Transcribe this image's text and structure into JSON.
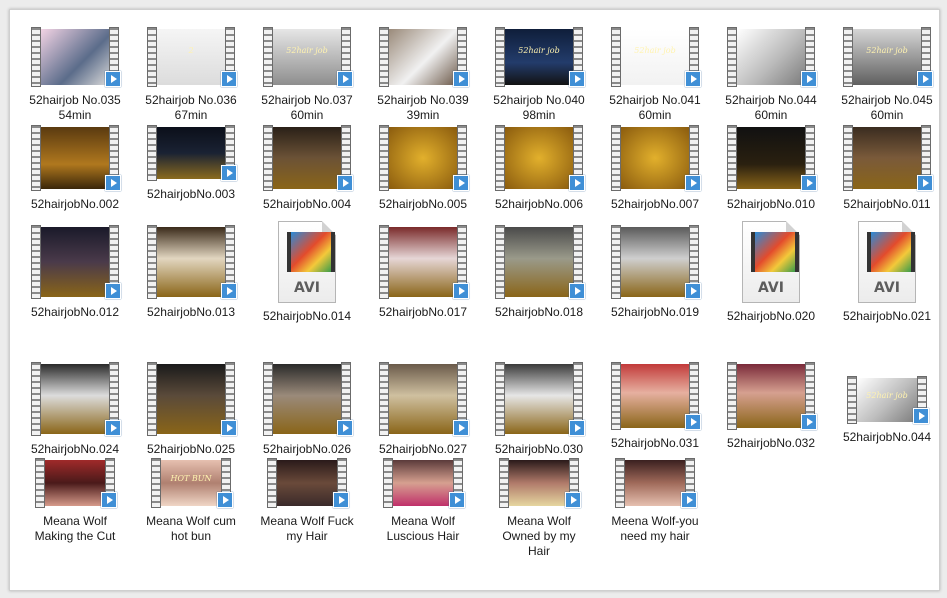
{
  "icons": {
    "play_badge": "play-badge-icon",
    "avi_file": "avi-file-icon"
  },
  "avi_label": "AVI",
  "items": [
    {
      "label": [
        "52hairjob No.035",
        "54min"
      ],
      "kind": "video",
      "bg": "linear-gradient(135deg,#f2d3e4,#5b6c8a 60%,#d9d9d9)"
    },
    {
      "label": [
        "52hairjob No.036",
        "67min"
      ],
      "kind": "video",
      "bg": "linear-gradient(#f5f5f5,#dcdcdc)",
      "caption": "2"
    },
    {
      "label": [
        "52hairjob No.037",
        "60min"
      ],
      "kind": "video",
      "bg": "linear-gradient(#e6e6e6,#8e8e8e)",
      "caption": "52hair job"
    },
    {
      "label": [
        "52hairjob No.039",
        "39min"
      ],
      "kind": "video",
      "bg": "linear-gradient(135deg,#9a8a7a,#f1f1f1 55%,#6d5a4a)"
    },
    {
      "label": [
        "52hairjob No.040",
        "98min"
      ],
      "kind": "video",
      "bg": "linear-gradient(#0f1e3a,#233c6b 60%,#121212)",
      "caption": "52hair job"
    },
    {
      "label": [
        "52hairjob No.041",
        "60min"
      ],
      "kind": "video",
      "bg": "linear-gradient(#ffffff,#f2f2f2)",
      "caption": "52hair job"
    },
    {
      "label": [
        "52hairjob No.044",
        "60min"
      ],
      "kind": "video",
      "bg": "linear-gradient(135deg,#ffffff,#bdbdbd 55%,#7b7b7b)"
    },
    {
      "label": [
        "52hairjob No.045",
        "60min"
      ],
      "kind": "video",
      "bg": "linear-gradient(#d6d6d6,#5f5f5f)",
      "caption": "52hair job"
    },
    {
      "label": [
        "52hairjobNo.002"
      ],
      "kind": "video",
      "bg": "linear-gradient(#5a3a10,#b0781e 60%,#3a260a)"
    },
    {
      "label": [
        "52hairjobNo.003"
      ],
      "kind": "video",
      "bg": "linear-gradient(#0b0f1a,#1a2233 50%,#8a6b1f)"
    },
    {
      "label": [
        "52hairjobNo.004"
      ],
      "kind": "video",
      "bg": "linear-gradient(#2a2018,#6b5236 50%,#8a6518)"
    },
    {
      "label": [
        "52hairjobNo.005"
      ],
      "kind": "video",
      "bg": "radial-gradient(#e2b02c,#8a5b0e)"
    },
    {
      "label": [
        "52hairjobNo.006"
      ],
      "kind": "video",
      "bg": "radial-gradient(#e2b02c,#8a5b0e)"
    },
    {
      "label": [
        "52hairjobNo.007"
      ],
      "kind": "video",
      "bg": "radial-gradient(#e2b02c,#8a5b0e)"
    },
    {
      "label": [
        "52hairjobNo.010"
      ],
      "kind": "video",
      "bg": "linear-gradient(#111111,#2a2010 60%,#8a6518)"
    },
    {
      "label": [
        "52hairjobNo.011"
      ],
      "kind": "video",
      "bg": "linear-gradient(#3a2c20,#7a5a3a 50%,#8a6518)"
    },
    {
      "label": [
        "52hairjobNo.012"
      ],
      "kind": "video",
      "bg": "linear-gradient(#1a1a2a,#4a3a4a 50%,#8a6518)"
    },
    {
      "label": [
        "52hairjobNo.013"
      ],
      "kind": "video",
      "bg": "linear-gradient(#3a2a1a,#e2d6c0 45%,#8a6518)"
    },
    {
      "label": [
        "52hairjobNo.014"
      ],
      "kind": "avi"
    },
    {
      "label": [
        "52hairjobNo.017"
      ],
      "kind": "video",
      "bg": "linear-gradient(#7a2a2a,#e6d6d6 45%,#8a6518)"
    },
    {
      "label": [
        "52hairjobNo.018"
      ],
      "kind": "video",
      "bg": "linear-gradient(#4a4a4a,#9a9a8a 45%,#8a6518)"
    },
    {
      "label": [
        "52hairjobNo.019"
      ],
      "kind": "video",
      "bg": "linear-gradient(#5a5a5a,#cfcfcf 45%,#8a6518)"
    },
    {
      "label": [
        "52hairjobNo.020"
      ],
      "kind": "avi"
    },
    {
      "label": [
        "52hairjobNo.021"
      ],
      "kind": "avi"
    },
    {
      "label": [
        "52hairjobNo.024"
      ],
      "kind": "video",
      "bg": "linear-gradient(#2a2a2a,#dcdcdc 45%,#8a6518)"
    },
    {
      "label": [
        "52hairjobNo.025"
      ],
      "kind": "video",
      "bg": "linear-gradient(#1a1a1a,#5a4a3a 45%,#8a6518)"
    },
    {
      "label": [
        "52hairjobNo.026"
      ],
      "kind": "video",
      "bg": "linear-gradient(#2a2a2a,#9a8a7a 45%,#8a6518)"
    },
    {
      "label": [
        "52hairjobNo.027"
      ],
      "kind": "video",
      "bg": "linear-gradient(#6a5a4a,#cfc0a0 45%,#8a6518)"
    },
    {
      "label": [
        "52hairjobNo.030"
      ],
      "kind": "video",
      "bg": "linear-gradient(#3a3a3a,#e6e6e6 45%,#8a6518)"
    },
    {
      "label": [
        "52hairjobNo.031"
      ],
      "kind": "video",
      "bg": "linear-gradient(#c23a3a,#e6b0a0 45%,#8a6518)"
    },
    {
      "label": [
        "52hairjobNo.032"
      ],
      "kind": "video",
      "bg": "linear-gradient(#7a2a3a,#d6a090 45%,#8a6518)"
    },
    {
      "label": [
        "52hairjobNo.044"
      ],
      "kind": "video",
      "bg": "linear-gradient(135deg,#ffffff,#bdbdbd 55%,#7b7b7b)",
      "caption": "52hair job"
    },
    {
      "label": [
        "Meana Wolf",
        "Making the Cut"
      ],
      "kind": "video",
      "bg": "linear-gradient(#a02a2a,#4a1a1a 50%,#d69a8a)"
    },
    {
      "label": [
        "Meana Wolf cum",
        "hot bun"
      ],
      "kind": "video",
      "bg": "linear-gradient(#e6c0b0,#b08070 50%,#f0d6c6)",
      "caption": "HOT BUN"
    },
    {
      "label": [
        "Meana Wolf Fuck",
        "my Hair"
      ],
      "kind": "video",
      "bg": "linear-gradient(#2a1a1a,#6a4a3a 50%,#3a2a2a)"
    },
    {
      "label": [
        "Meana Wolf",
        "Luscious Hair"
      ],
      "kind": "video",
      "bg": "linear-gradient(#5a3a3a,#d6a090 50%,#c0306a)"
    },
    {
      "label": [
        "Meana Wolf",
        "Owned by my",
        "Hair"
      ],
      "kind": "video",
      "bg": "linear-gradient(#2a1a1a,#b07a6a 50%,#e6d6a0)"
    },
    {
      "label": [
        "Meena Wolf-you",
        "need my hair"
      ],
      "kind": "video",
      "bg": "linear-gradient(#3a2020,#a06a5a 50%,#e6c0b0)"
    }
  ]
}
